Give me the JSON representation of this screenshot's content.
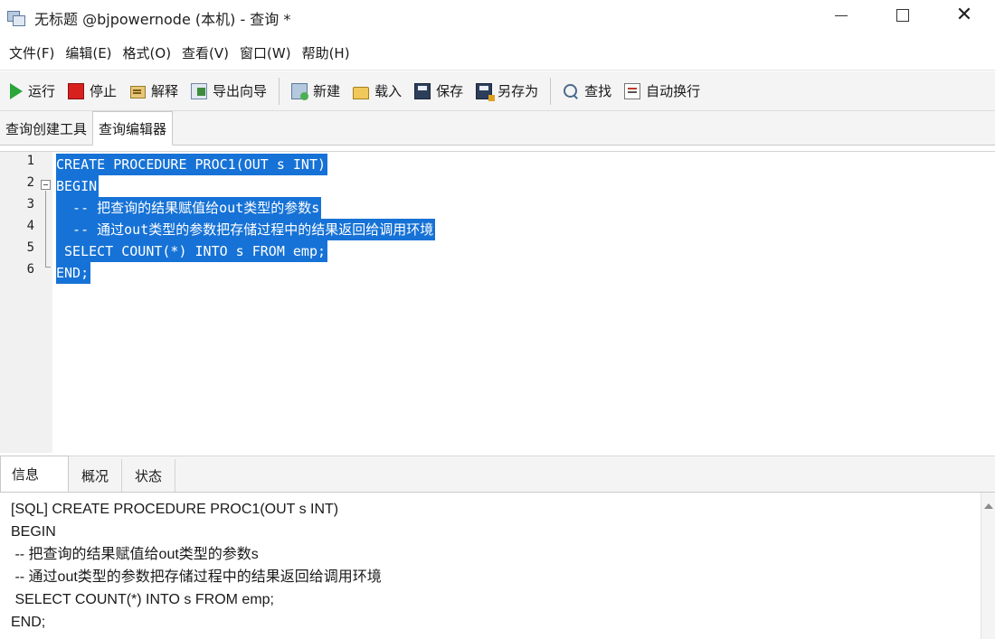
{
  "window": {
    "title": "无标题 @bjpowernode (本机) - 查询 *",
    "minimize_icon": "minimize-icon",
    "maximize_icon": "maximize-icon",
    "close_icon": "close-icon"
  },
  "menu": {
    "items": [
      "文件(F)",
      "编辑(E)",
      "格式(O)",
      "查看(V)",
      "窗口(W)",
      "帮助(H)"
    ]
  },
  "toolbar": {
    "run": "运行",
    "stop": "停止",
    "explain": "解释",
    "export_wizard": "导出向导",
    "new": "新建",
    "load": "载入",
    "save": "保存",
    "save_as": "另存为",
    "find": "查找",
    "word_wrap": "自动换行"
  },
  "editor_tabs": {
    "query_builder": "查询创建工具",
    "query_editor": "查询编辑器",
    "active": "查询编辑器"
  },
  "editor": {
    "line_numbers": [
      "1",
      "2",
      "3",
      "4",
      "5",
      "6"
    ],
    "lines": [
      "CREATE PROCEDURE PROC1(OUT s INT)",
      "BEGIN",
      "  -- 把查询的结果赋值给out类型的参数s",
      "  -- 通过out类型的参数把存储过程中的结果返回给调用环境",
      " SELECT COUNT(*) INTO s FROM emp;",
      "END;"
    ],
    "selection_color": "#1672d6"
  },
  "bottom_tabs": {
    "info": "信息",
    "summary": "概况",
    "status": "状态",
    "active": "信息"
  },
  "message": {
    "lines": [
      "[SQL] CREATE PROCEDURE PROC1(OUT s INT)",
      "BEGIN",
      " -- 把查询的结果赋值给out类型的参数s",
      " -- 通过out类型的参数把存储过程中的结果返回给调用环境",
      " SELECT COUNT(*) INTO s FROM emp;",
      "END;"
    ]
  }
}
